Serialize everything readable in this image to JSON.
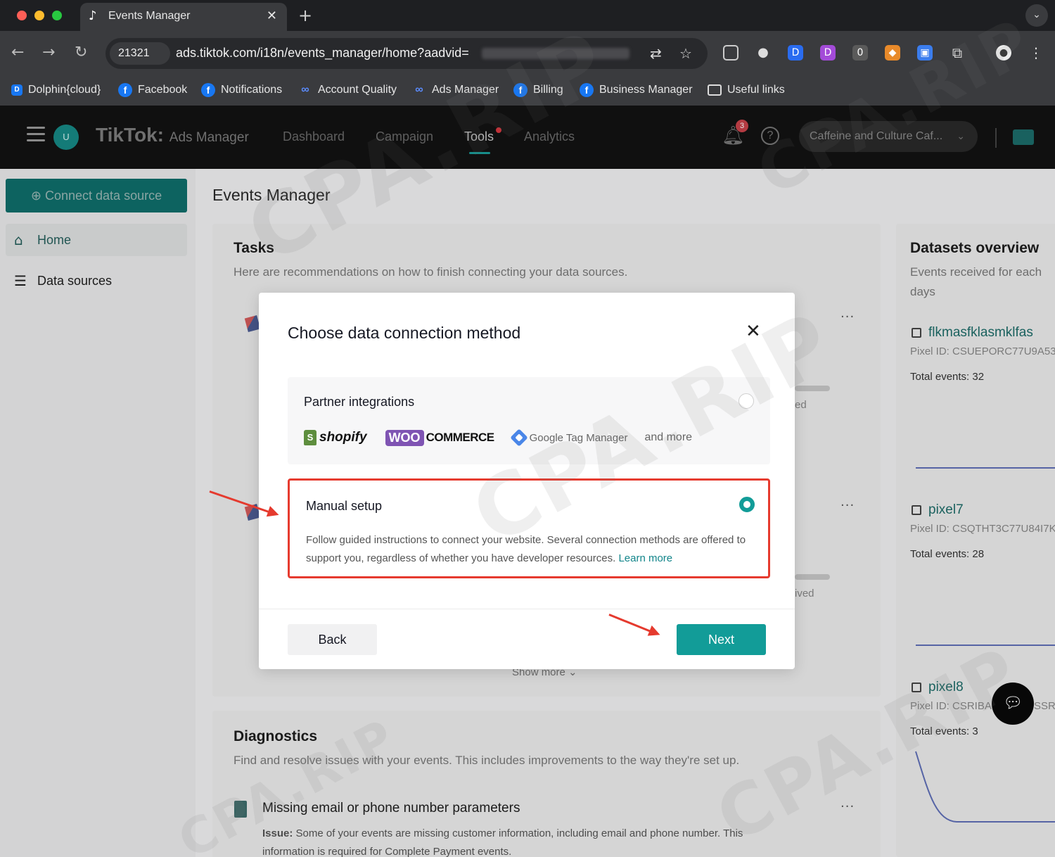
{
  "browser": {
    "tab_title": "Events Manager",
    "tab_favicon": "♪",
    "new_tab": "+",
    "site_badge": "21321",
    "url": "ads.tiktok.com/i18n/events_manager/home?aadvid=",
    "bookmarks": [
      {
        "label": "Dolphin{cloud}",
        "icon": "dolphin-icon"
      },
      {
        "label": "Facebook",
        "icon": "facebook-icon"
      },
      {
        "label": "Notifications",
        "icon": "facebook-icon"
      },
      {
        "label": "Account Quality",
        "icon": "meta-icon"
      },
      {
        "label": "Ads Manager",
        "icon": "meta-icon"
      },
      {
        "label": "Billing",
        "icon": "facebook-icon"
      },
      {
        "label": "Business Manager",
        "icon": "facebook-icon"
      },
      {
        "label": "Useful links",
        "icon": "folder-icon"
      }
    ],
    "extension_badge": "0"
  },
  "app": {
    "avatar_initial": "U",
    "brand": "TikTok",
    "brand_sub": "Ads Manager",
    "nav": [
      "Dashboard",
      "Campaign",
      "Tools",
      "Analytics"
    ],
    "notification_count": "3",
    "help": "?",
    "account": "Caffeine and Culture Caf..."
  },
  "sidebar": {
    "connect_button": "Connect data source",
    "items": [
      "Home",
      "Data sources"
    ]
  },
  "page": {
    "title": "Events Manager",
    "tasks": {
      "title": "Tasks",
      "subtitle": "Here are recommendations on how to finish connecting your data sources.",
      "show_more": "Show more",
      "partial_1": "ed",
      "partial_2": "ived"
    },
    "diagnostics": {
      "title": "Diagnostics",
      "subtitle": "Find and resolve issues with your events. This includes improvements to the way they're set up.",
      "issue_title": "Missing email or phone number parameters",
      "issue_label": "Issue:",
      "issue_text": "Some of your events are missing customer information, including email and phone number. This information is required for Complete Payment events."
    },
    "datasets": {
      "title": "Datasets overview",
      "subtitle": "Events received for each",
      "subtitle2": "days",
      "items": [
        {
          "name": "flkmasfklasmklfas",
          "pixel": "Pixel ID: CSUEPORC77U9A53",
          "total": "Total events: 32"
        },
        {
          "name": "pixel7",
          "pixel": "Pixel ID: CSQTHT3C77U84I7K",
          "total": "Total events: 28"
        },
        {
          "name": "pixel8",
          "pixel": "Pixel ID: CSRIBA",
          "total": "Total events: 3",
          "pixel_tail": "SSRI"
        }
      ]
    }
  },
  "modal": {
    "title": "Choose data connection method",
    "option_partner": {
      "title": "Partner integrations",
      "logos": {
        "shopify": "shopify",
        "woo_mark": "WOO",
        "woo_word": "COMMERCE",
        "gtm": "Google Tag Manager",
        "more": "and more"
      },
      "selected": false
    },
    "option_manual": {
      "title": "Manual setup",
      "description": "Follow guided instructions to connect your website. Several connection methods are offered to support you, regardless of whether you have developer resources.",
      "learn_more": "Learn more",
      "selected": true
    },
    "back_button": "Back",
    "next_button": "Next"
  },
  "watermark": "CPA.RIP",
  "colors": {
    "accent": "#129c98",
    "highlight": "#e63b2f"
  }
}
